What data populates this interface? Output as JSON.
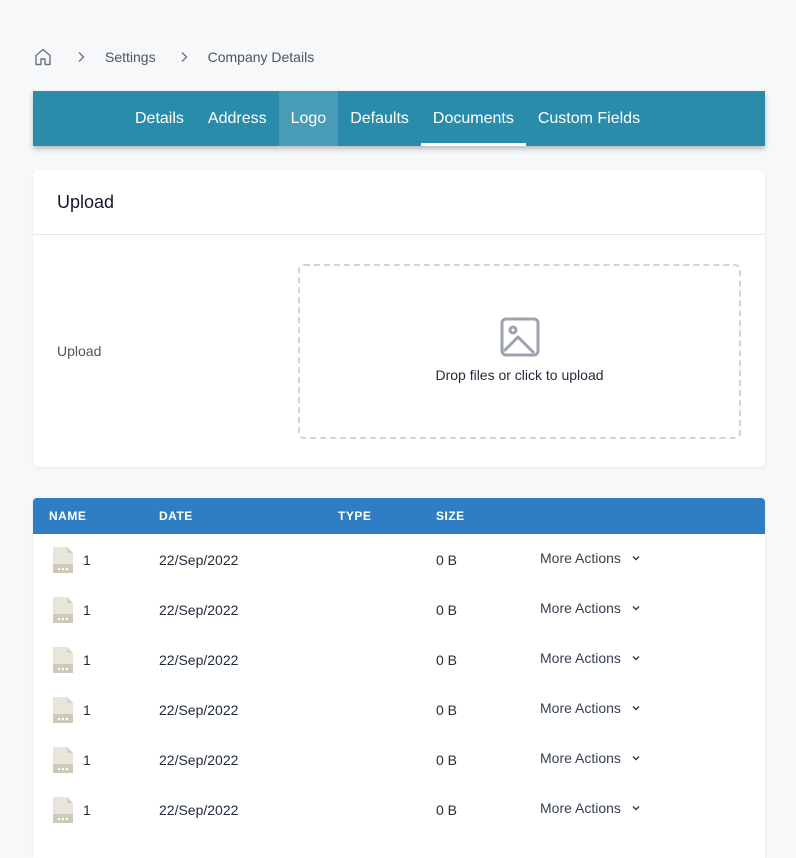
{
  "breadcrumb": {
    "home_icon": "home-icon",
    "items": [
      "Settings",
      "Company Details"
    ]
  },
  "tabs": [
    {
      "label": "Details"
    },
    {
      "label": "Address"
    },
    {
      "label": "Logo"
    },
    {
      "label": "Defaults"
    },
    {
      "label": "Documents"
    },
    {
      "label": "Custom Fields"
    }
  ],
  "upload_card": {
    "title": "Upload",
    "field_label": "Upload",
    "dropzone_text": "Drop files or click to upload",
    "dropzone_icon": "image-icon"
  },
  "table": {
    "columns": [
      "NAME",
      "DATE",
      "TYPE",
      "SIZE"
    ],
    "rows": [
      {
        "name": "1",
        "date": "22/Sep/2022",
        "type": "",
        "size": "0 B",
        "action": "More Actions"
      },
      {
        "name": "1",
        "date": "22/Sep/2022",
        "type": "",
        "size": "0 B",
        "action": "More Actions"
      },
      {
        "name": "1",
        "date": "22/Sep/2022",
        "type": "",
        "size": "0 B",
        "action": "More Actions"
      },
      {
        "name": "1",
        "date": "22/Sep/2022",
        "type": "",
        "size": "0 B",
        "action": "More Actions"
      },
      {
        "name": "1",
        "date": "22/Sep/2022",
        "type": "",
        "size": "0 B",
        "action": "More Actions"
      },
      {
        "name": "1",
        "date": "22/Sep/2022",
        "type": "",
        "size": "0 B",
        "action": "More Actions"
      }
    ]
  },
  "colors": {
    "tabbar": "#2a8cab",
    "table_header": "#2f7ec4",
    "page_bg": "#f7f8fa"
  }
}
